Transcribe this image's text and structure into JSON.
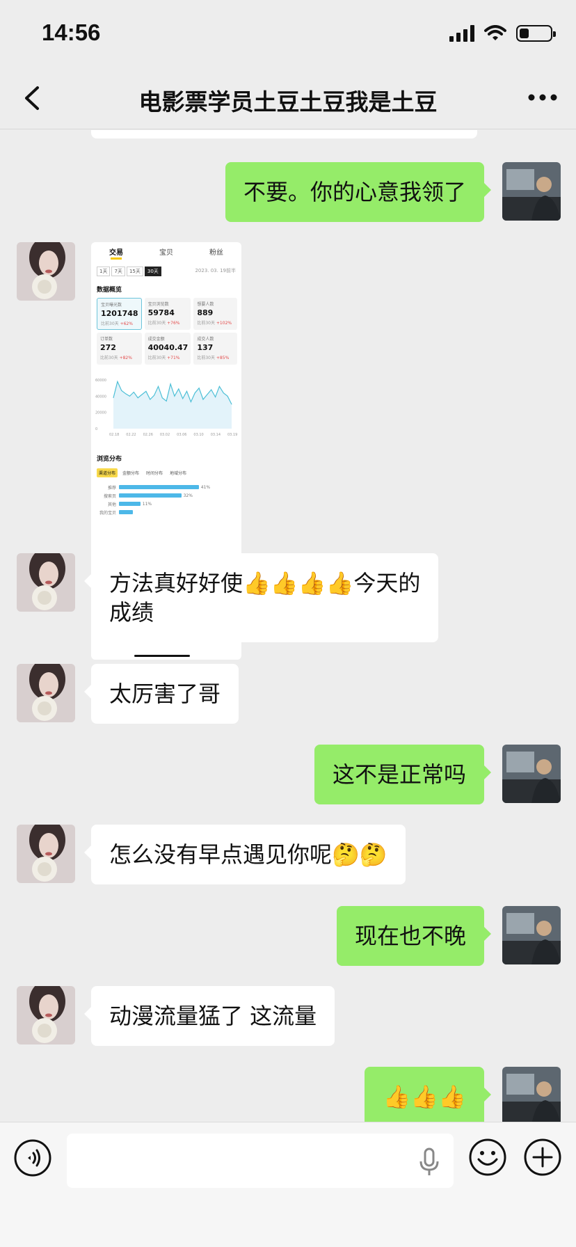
{
  "status_bar": {
    "time": "14:56",
    "signal_icon": "cellular-signal-icon",
    "wifi_icon": "wifi-icon",
    "battery_icon": "battery-icon"
  },
  "header": {
    "title": "电影票学员土豆土豆我是土豆",
    "back_icon": "chevron-left-icon",
    "more_icon": "more-dots-icon"
  },
  "messages": [
    {
      "side": "out",
      "text": "不要。你的心意我领了"
    },
    {
      "side": "in",
      "type": "image"
    },
    {
      "side": "in",
      "text_line1": "方法真好好使👍👍👍👍今天的",
      "text_line2": "成绩"
    },
    {
      "side": "in",
      "text": "太厉害了哥"
    },
    {
      "side": "out",
      "text": "这不是正常吗"
    },
    {
      "side": "in",
      "text": "怎么没有早点遇见你呢🤔🤔"
    },
    {
      "side": "out",
      "text": "现在也不晚"
    },
    {
      "side": "in",
      "text": "动漫流量猛了 这流量"
    },
    {
      "side": "out",
      "text": "👍👍👍"
    }
  ],
  "shared_image": {
    "tabs": [
      "交易",
      "宝贝",
      "粉丝"
    ],
    "ranges": [
      "1天",
      "7天",
      "15天",
      "30天"
    ],
    "date": "2023. 03. 19前半",
    "section_title": "数据概览",
    "cards": [
      {
        "label": "宝贝曝光数",
        "value": "1201748",
        "compare": "比前30天",
        "change": "+62%"
      },
      {
        "label": "宝贝浏览数",
        "value": "59784",
        "compare": "比前30天",
        "change": "+76%"
      },
      {
        "label": "想要人数",
        "value": "889",
        "compare": "比前30天",
        "change": "+102%"
      },
      {
        "label": "订单数",
        "value": "272",
        "compare": "比前30天",
        "change": "+82%"
      },
      {
        "label": "成交金额",
        "value": "40040.47",
        "compare": "比前30天",
        "change": "+71%"
      },
      {
        "label": "成交人数",
        "value": "137",
        "compare": "比前30天",
        "change": "+85%"
      }
    ],
    "chart": {
      "y_ticks": [
        "60000",
        "40000",
        "20000",
        "0"
      ],
      "x_ticks": [
        "02.18",
        "02.22",
        "02.26",
        "03.02",
        "03.06",
        "03.10",
        "03.14",
        "03.19"
      ],
      "values": [
        38000,
        58000,
        47000,
        43000,
        40000,
        45000,
        38000,
        42000,
        46000,
        36000,
        41000,
        52000,
        38000,
        34000,
        55000,
        40000,
        49000,
        37000,
        46000,
        33000,
        44000,
        50000,
        36000,
        42000,
        48000,
        39000,
        52000,
        44000,
        40000,
        30000
      ],
      "ylim": [
        0,
        60000
      ],
      "line_color": "#4cbfd6",
      "fill_color": "#e3f3fa"
    },
    "dist_title": "浏览分布",
    "dist_tabs": [
      "渠道分布",
      "金额分布",
      "时间分布",
      "地域分布"
    ],
    "dist_rows": [
      {
        "label": "推荐",
        "value": 41,
        "pct": "41%"
      },
      {
        "label": "搜索页",
        "value": 32,
        "pct": "32%"
      },
      {
        "label": "其他",
        "value": 11,
        "pct": "11%"
      },
      {
        "label": "我的宝贝",
        "value": 7,
        "pct": ""
      }
    ]
  },
  "input_bar": {
    "placeholder": "",
    "voice_icon": "voice-icon",
    "mic_icon": "microphone-icon",
    "emoji_icon": "emoji-icon",
    "plus_icon": "plus-icon"
  },
  "colors": {
    "background": "#ededed",
    "incoming_bubble": "#ffffff",
    "outgoing_bubble": "#95ec69"
  }
}
